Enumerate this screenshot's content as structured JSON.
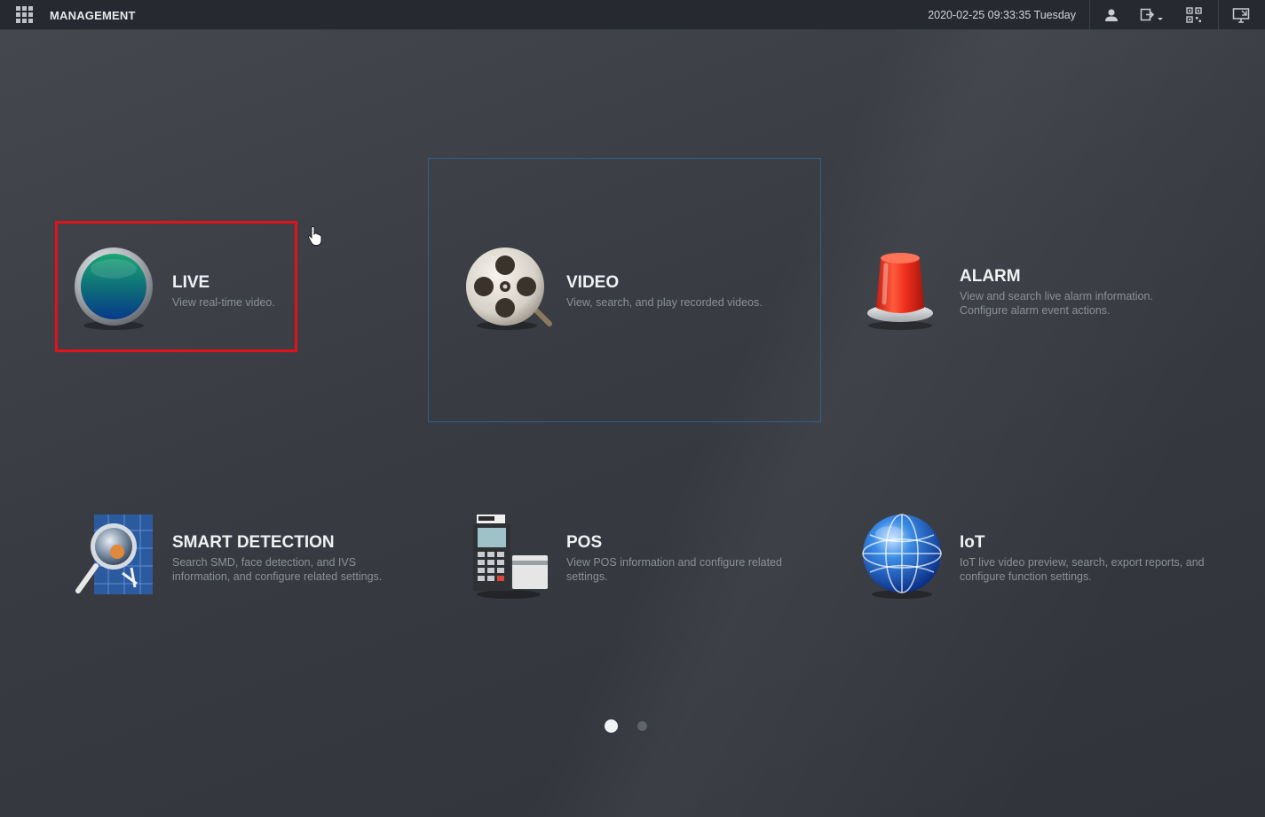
{
  "topbar": {
    "brand": "MANAGEMENT",
    "datetime": "2020-02-25 09:33:35 Tuesday",
    "icons": [
      "apps-grid-icon",
      "user-icon",
      "logout-icon",
      "qr-code-icon",
      "display-icon"
    ]
  },
  "tiles": {
    "live": {
      "title": "LIVE",
      "desc": "View real-time video."
    },
    "video": {
      "title": "VIDEO",
      "desc": "View, search, and play recorded videos."
    },
    "alarm": {
      "title": "ALARM",
      "desc": "View and search live alarm information. Configure alarm event actions."
    },
    "smart": {
      "title": "SMART DETECTION",
      "desc": "Search SMD, face detection, and IVS information, and configure related settings."
    },
    "pos": {
      "title": "POS",
      "desc": "View POS information and configure related settings."
    },
    "iot": {
      "title": "IoT",
      "desc": "IoT live video preview, search, export reports, and configure function settings."
    }
  },
  "pagination": {
    "total_pages": 2,
    "current_page": 1
  },
  "colors": {
    "highlight": "#e3121a",
    "selection": "#2f5f8f",
    "background": "#3a3d44"
  }
}
